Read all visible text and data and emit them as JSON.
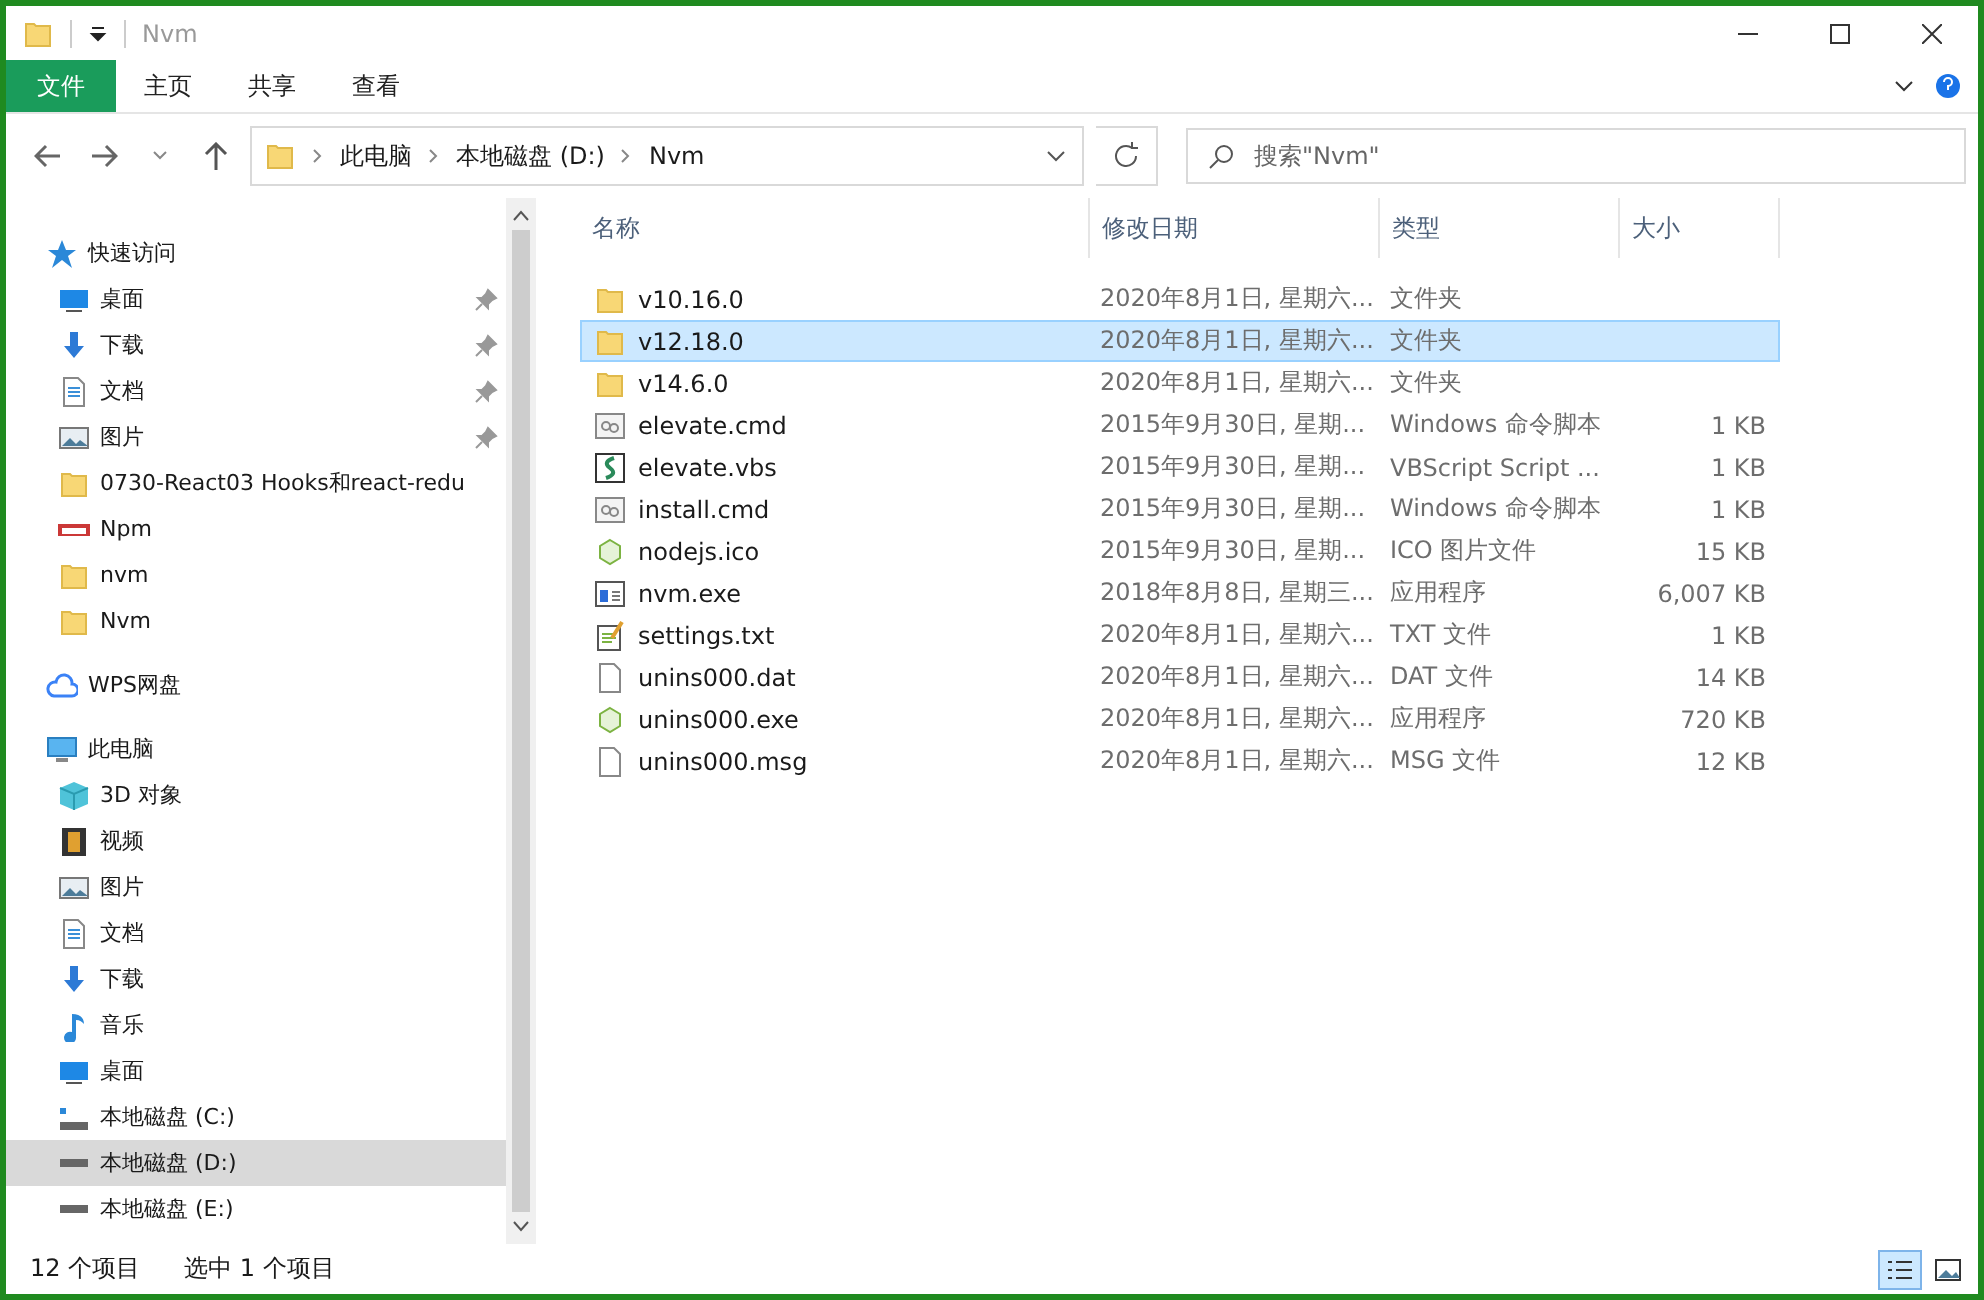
{
  "window": {
    "title": "Nvm"
  },
  "ribbon_tabs": [
    {
      "label": "文件",
      "selected": true
    },
    {
      "label": "主页",
      "selected": false
    },
    {
      "label": "共享",
      "selected": false
    },
    {
      "label": "查看",
      "selected": false
    }
  ],
  "address": {
    "crumbs": [
      "此电脑",
      "本地磁盘 (D:)",
      "Nvm"
    ]
  },
  "search": {
    "placeholder": "搜索\"Nvm\""
  },
  "sidebar": [
    {
      "label": "快速访问",
      "kind": "star",
      "selected": false,
      "children": [
        {
          "label": "桌面",
          "kind": "desktop",
          "pinned": true,
          "selected": false
        },
        {
          "label": "下载",
          "kind": "download",
          "pinned": true,
          "selected": false
        },
        {
          "label": "文档",
          "kind": "document",
          "pinned": true,
          "selected": false
        },
        {
          "label": "图片",
          "kind": "picture",
          "pinned": true,
          "selected": false
        },
        {
          "label": "0730-React03 Hooks和react-redu",
          "kind": "folder",
          "pinned": false,
          "selected": false
        },
        {
          "label": "Npm",
          "kind": "npm",
          "pinned": false,
          "selected": false
        },
        {
          "label": "nvm",
          "kind": "folder",
          "pinned": false,
          "selected": false
        },
        {
          "label": "Nvm",
          "kind": "folder",
          "pinned": false,
          "selected": false
        }
      ]
    },
    {
      "label": "WPS网盘",
      "kind": "cloud",
      "selected": false
    },
    {
      "label": "此电脑",
      "kind": "pc",
      "selected": false,
      "children": [
        {
          "label": "3D 对象",
          "kind": "cube",
          "pinned": false,
          "selected": false
        },
        {
          "label": "视频",
          "kind": "video",
          "pinned": false,
          "selected": false
        },
        {
          "label": "图片",
          "kind": "picture",
          "pinned": false,
          "selected": false
        },
        {
          "label": "文档",
          "kind": "document",
          "pinned": false,
          "selected": false
        },
        {
          "label": "下载",
          "kind": "download",
          "pinned": false,
          "selected": false
        },
        {
          "label": "音乐",
          "kind": "music",
          "pinned": false,
          "selected": false
        },
        {
          "label": "桌面",
          "kind": "desktop",
          "pinned": false,
          "selected": false
        },
        {
          "label": "本地磁盘 (C:)",
          "kind": "drive-c",
          "pinned": false,
          "selected": false
        },
        {
          "label": "本地磁盘 (D:)",
          "kind": "drive",
          "pinned": false,
          "selected": true
        },
        {
          "label": "本地磁盘 (E:)",
          "kind": "drive",
          "pinned": false,
          "selected": false
        }
      ]
    }
  ],
  "table": {
    "columns": [
      "名称",
      "修改日期",
      "类型",
      "大小"
    ],
    "rows": [
      {
        "name": "v10.16.0",
        "date": "2020年8月1日, 星期六...",
        "type": "文件夹",
        "kind": "folder",
        "selected": false
      },
      {
        "name": "v12.18.0",
        "date": "2020年8月1日, 星期六...",
        "type": "文件夹",
        "kind": "folder",
        "selected": true
      },
      {
        "name": "v14.6.0",
        "date": "2020年8月1日, 星期六...",
        "type": "文件夹",
        "kind": "folder",
        "selected": false
      },
      {
        "name": "elevate.cmd",
        "date": "2015年9月30日, 星期...",
        "type": "Windows 命令脚本",
        "size": "1 KB",
        "kind": "cmd",
        "selected": false
      },
      {
        "name": "elevate.vbs",
        "date": "2015年9月30日, 星期...",
        "type": "VBScript Script ...",
        "size": "1 KB",
        "kind": "vbs",
        "selected": false
      },
      {
        "name": "install.cmd",
        "date": "2015年9月30日, 星期...",
        "type": "Windows 命令脚本",
        "size": "1 KB",
        "kind": "cmd",
        "selected": false
      },
      {
        "name": "nodejs.ico",
        "date": "2015年9月30日, 星期...",
        "type": "ICO 图片文件",
        "size": "15 KB",
        "kind": "node",
        "selected": false
      },
      {
        "name": "nvm.exe",
        "date": "2018年8月8日, 星期三...",
        "type": "应用程序",
        "size": "6,007 KB",
        "kind": "exe",
        "selected": false
      },
      {
        "name": "settings.txt",
        "date": "2020年8月1日, 星期六...",
        "type": "TXT 文件",
        "size": "1 KB",
        "kind": "txt",
        "selected": false
      },
      {
        "name": "unins000.dat",
        "date": "2020年8月1日, 星期六...",
        "type": "DAT 文件",
        "size": "14 KB",
        "kind": "file",
        "selected": false
      },
      {
        "name": "unins000.exe",
        "date": "2020年8月1日, 星期六...",
        "type": "应用程序",
        "size": "720 KB",
        "kind": "node",
        "selected": false
      },
      {
        "name": "unins000.msg",
        "date": "2020年8月1日, 星期六...",
        "type": "MSG 文件",
        "size": "12 KB",
        "kind": "file",
        "selected": false
      }
    ]
  },
  "status_bar": {
    "count": "12 个项目",
    "selection": "选中 1 个项目",
    "views": [
      {
        "kind": "details",
        "selected": true
      },
      {
        "kind": "large",
        "selected": false
      }
    ]
  }
}
